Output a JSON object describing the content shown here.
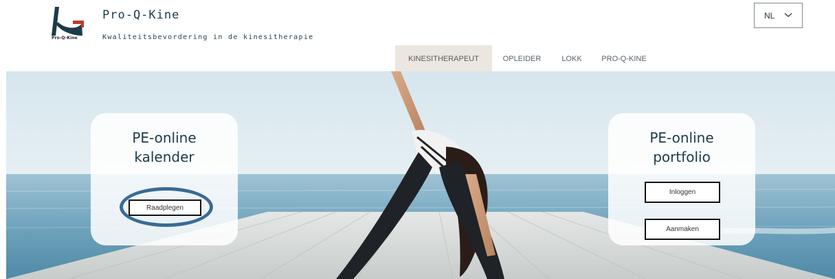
{
  "header": {
    "logo_text": "Pro-Q-Kine",
    "site_title": "Pro-Q-Kine",
    "tagline": "Kwaliteitsbevordering in de kinesitherapie",
    "language": {
      "selected": "NL",
      "icon": "chevron-down-icon"
    }
  },
  "nav": {
    "items": [
      {
        "label": "KINESITHERAPEUT",
        "active": true
      },
      {
        "label": "OPLEIDER",
        "active": false
      },
      {
        "label": "LOKK",
        "active": false
      },
      {
        "label": "PRO-Q-KINE",
        "active": false
      }
    ]
  },
  "hero": {
    "left_card": {
      "title_line1": "PE-online",
      "title_line2": "kalender",
      "button_label": "Raadplegen"
    },
    "right_card": {
      "title_line1": "PE-online",
      "title_line2": "portfolio",
      "login_label": "Inloggen",
      "create_label": "Aanmaken"
    }
  },
  "colors": {
    "brand_dark": "#1c3b4a",
    "logo_red": "#c0392b",
    "nav_active_bg": "#ebe6e0",
    "annotation_ring": "#3a6a96"
  }
}
